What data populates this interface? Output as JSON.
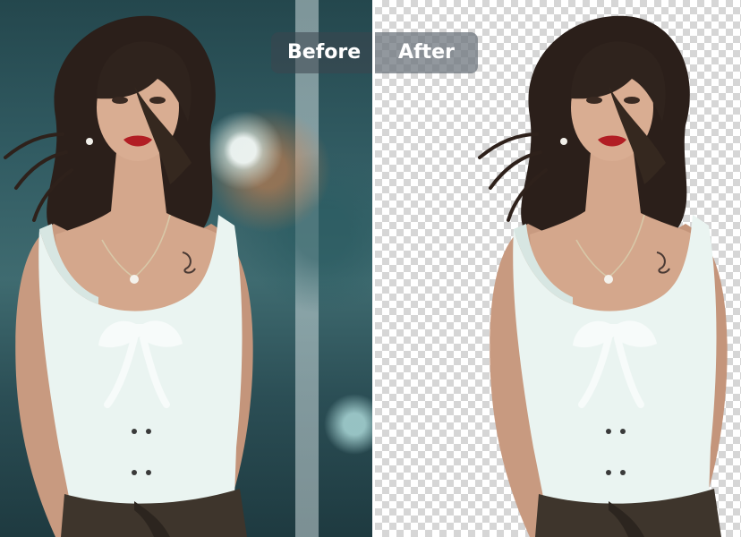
{
  "comparison": {
    "before_label": "Before",
    "after_label": "After"
  },
  "colors": {
    "label_before_bg": "#3c464e",
    "label_after_bg": "#6e767e",
    "label_text": "#ffffff",
    "checker_light": "#ffffff",
    "checker_dark": "#d6d6d6",
    "background_teal": "#315b62",
    "divider": "#ffffff"
  },
  "icons": {
    "transparency_pattern": "checkerboard-icon"
  }
}
